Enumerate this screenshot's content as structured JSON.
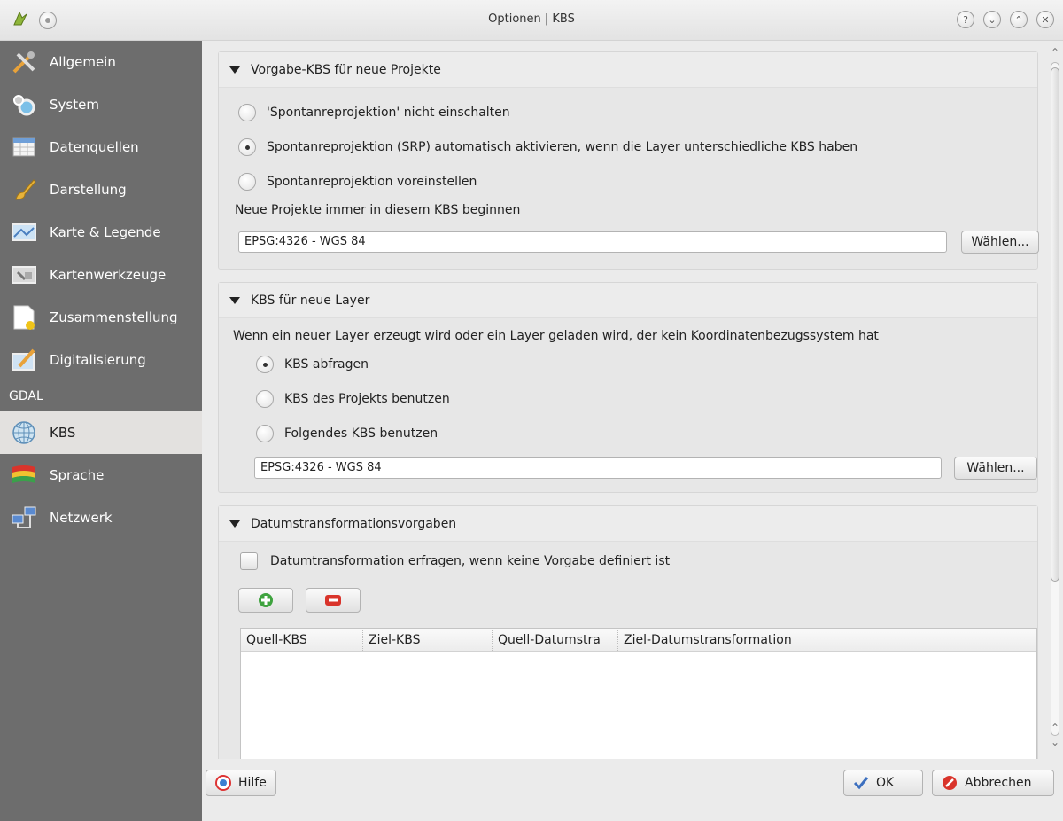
{
  "window": {
    "title": "Optionen | KBS"
  },
  "sidebar": {
    "items": [
      {
        "label": "Allgemein",
        "icon": "tools-icon"
      },
      {
        "label": "System",
        "icon": "gears-icon"
      },
      {
        "label": "Datenquellen",
        "icon": "table-icon"
      },
      {
        "label": "Darstellung",
        "icon": "brush-icon"
      },
      {
        "label": "Karte & Legende",
        "icon": "map-icon"
      },
      {
        "label": "Kartenwerkzeuge",
        "icon": "map-tools-icon"
      },
      {
        "label": "Zusammenstellung",
        "icon": "composer-icon"
      },
      {
        "label": "Digitalisierung",
        "icon": "digitize-icon"
      },
      {
        "label": "GDAL",
        "icon": ""
      },
      {
        "label": "KBS",
        "icon": "globe-icon"
      },
      {
        "label": "Sprache",
        "icon": "flag-icon"
      },
      {
        "label": "Netzwerk",
        "icon": "network-icon"
      }
    ],
    "active": "KBS"
  },
  "group1": {
    "title": "Vorgabe-KBS für neue Projekte",
    "radio1": "'Spontanreprojektion' nicht einschalten",
    "radio2": "Spontanreprojektion (SRP) automatisch aktivieren, wenn die Layer unterschiedliche KBS haben",
    "radio3": "Spontanreprojektion voreinstellen",
    "field_label": "Neue Projekte immer in diesem KBS beginnen",
    "field_value": "EPSG:4326 - WGS 84",
    "choose": "Wählen..."
  },
  "group2": {
    "title": "KBS für neue Layer",
    "description": "Wenn ein neuer Layer erzeugt wird oder ein Layer geladen wird, der kein Koordinatenbezugssystem hat",
    "radio1": "KBS abfragen",
    "radio2": "KBS des Projekts benutzen",
    "radio3": "Folgendes KBS benutzen",
    "field_value": "EPSG:4326 - WGS 84",
    "choose": "Wählen..."
  },
  "group3": {
    "title": "Datumstransformationsvorgaben",
    "checkbox": "Datumtransformation erfragen, wenn keine Vorgabe definiert ist",
    "columns": [
      "Quell-KBS",
      "Ziel-KBS",
      "Quell-Datumstra",
      "Ziel-Datumstransformation"
    ]
  },
  "footer": {
    "help": "Hilfe",
    "ok": "OK",
    "cancel": "Abbrechen"
  }
}
